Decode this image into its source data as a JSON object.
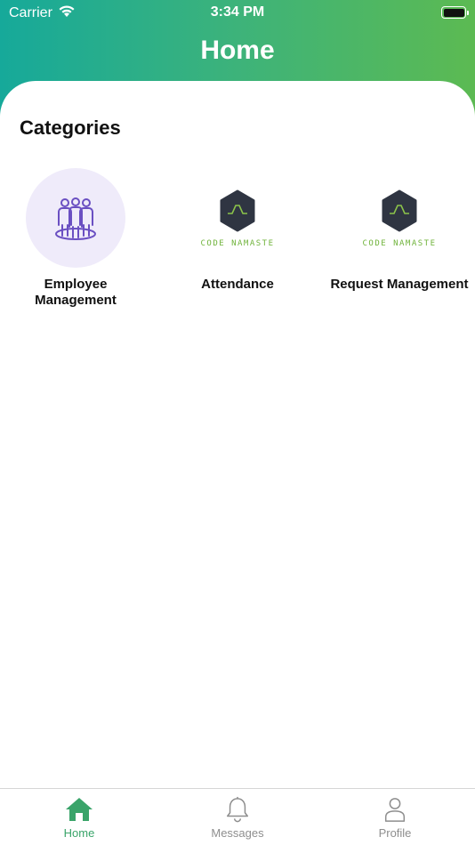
{
  "status_bar": {
    "carrier": "Carrier",
    "time": "3:34 PM",
    "wifi_icon": "wifi-icon",
    "battery_icon": "battery-icon"
  },
  "header": {
    "title": "Home",
    "gradient_start": "#16a99a",
    "gradient_end": "#5cba52"
  },
  "main": {
    "section_title": "Categories",
    "categories": [
      {
        "label": "Employee Management",
        "icon": "people-group-icon"
      },
      {
        "label": "Attendance",
        "icon": "code-namaste-logo",
        "logo_text": "CODE NAMASTE"
      },
      {
        "label": "Request Management",
        "icon": "code-namaste-logo",
        "logo_text": "CODE NAMASTE"
      }
    ]
  },
  "tabbar": {
    "tabs": [
      {
        "label": "Home",
        "icon": "home-icon",
        "active": true
      },
      {
        "label": "Messages",
        "icon": "bell-icon",
        "active": false
      },
      {
        "label": "Profile",
        "icon": "user-icon",
        "active": false
      }
    ],
    "active_color": "#3aa46a",
    "inactive_color": "#8e8e8e"
  }
}
